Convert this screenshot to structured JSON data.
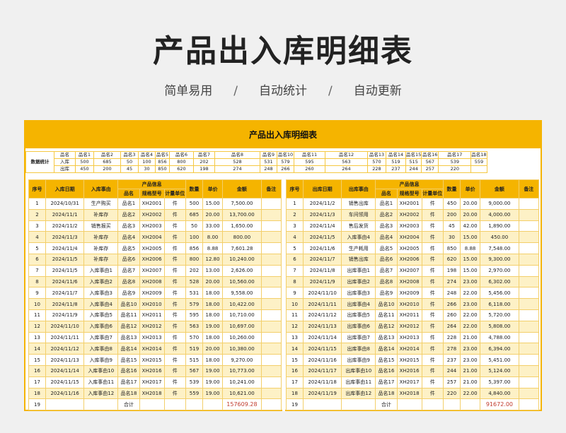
{
  "title": "产品出入库明细表",
  "subtitle": [
    "简单易用",
    "自动统计",
    "自动更新"
  ],
  "subtitle_sep": "/",
  "sheet_title": "产品出入库明细表",
  "stats": {
    "label": "数据统计",
    "row_labels": [
      "品名",
      "入库",
      "出库"
    ],
    "products": [
      "品名1",
      "品名2",
      "品名3",
      "品名4",
      "品名5",
      "品名6",
      "品名7",
      "品名8",
      "品名9",
      "品名10",
      "品名11",
      "品名12",
      "品名13",
      "品名14",
      "品名15",
      "品名16",
      "品名17",
      "品名18"
    ],
    "in": [
      "500",
      "685",
      "50",
      "100",
      "856",
      "800",
      "202",
      "528",
      "531",
      "579",
      "595",
      "563",
      "570",
      "519",
      "515",
      "567",
      "539",
      "559"
    ],
    "out": [
      "450",
      "200",
      "45",
      "30",
      "850",
      "620",
      "198",
      "274",
      "248",
      "266",
      "260",
      "264",
      "228",
      "237",
      "244",
      "257",
      "220",
      ""
    ]
  },
  "headers": {
    "seq": "序号",
    "product_info": "产品信息",
    "name": "品名",
    "model": "规格型号",
    "unit": "计量单位",
    "qty": "数量",
    "price": "单价",
    "amount": "金额",
    "note": "备注"
  },
  "inbound": {
    "date_header": "入库日期",
    "reason_header": "入库事由",
    "rows": [
      [
        "1",
        "2024/10/31",
        "生产购买",
        "品名1",
        "XH2001",
        "件",
        "500",
        "15.00",
        "7,500.00",
        ""
      ],
      [
        "2",
        "2024/11/1",
        "补库存",
        "品名2",
        "XH2002",
        "件",
        "685",
        "20.00",
        "13,700.00",
        ""
      ],
      [
        "3",
        "2024/11/2",
        "销售报买",
        "品名3",
        "XH2003",
        "件",
        "50",
        "33.00",
        "1,650.00",
        ""
      ],
      [
        "4",
        "2024/11/3",
        "补库存",
        "品名4",
        "XH2004",
        "件",
        "100",
        "8.00",
        "800.00",
        ""
      ],
      [
        "5",
        "2024/11/4",
        "补库存",
        "品名5",
        "XH2005",
        "件",
        "856",
        "8.88",
        "7,601.28",
        ""
      ],
      [
        "6",
        "2024/11/5",
        "补库存",
        "品名6",
        "XH2006",
        "件",
        "800",
        "12.80",
        "10,240.00",
        ""
      ],
      [
        "7",
        "2024/11/5",
        "入库事由1",
        "品名7",
        "XH2007",
        "件",
        "202",
        "13.00",
        "2,626.00",
        ""
      ],
      [
        "8",
        "2024/11/6",
        "入库事由2",
        "品名8",
        "XH2008",
        "件",
        "528",
        "20.00",
        "10,560.00",
        ""
      ],
      [
        "9",
        "2024/11/7",
        "入库事由3",
        "品名9",
        "XH2009",
        "件",
        "531",
        "18.00",
        "9,558.00",
        ""
      ],
      [
        "10",
        "2024/11/8",
        "入库事由4",
        "品名10",
        "XH2010",
        "件",
        "579",
        "18.00",
        "10,422.00",
        ""
      ],
      [
        "11",
        "2024/11/9",
        "入库事由5",
        "品名11",
        "XH2011",
        "件",
        "595",
        "18.00",
        "10,710.00",
        ""
      ],
      [
        "12",
        "2024/11/10",
        "入库事由6",
        "品名12",
        "XH2012",
        "件",
        "563",
        "19.00",
        "10,697.00",
        ""
      ],
      [
        "13",
        "2024/11/11",
        "入库事由7",
        "品名13",
        "XH2013",
        "件",
        "570",
        "18.00",
        "10,260.00",
        ""
      ],
      [
        "14",
        "2024/11/12",
        "入库事由8",
        "品名14",
        "XH2014",
        "件",
        "519",
        "20.00",
        "10,380.00",
        ""
      ],
      [
        "15",
        "2024/11/13",
        "入库事由9",
        "品名15",
        "XH2015",
        "件",
        "515",
        "18.00",
        "9,270.00",
        ""
      ],
      [
        "16",
        "2024/11/14",
        "入库事由10",
        "品名16",
        "XH2016",
        "件",
        "567",
        "19.00",
        "10,773.00",
        ""
      ],
      [
        "17",
        "2024/11/15",
        "入库事由11",
        "品名17",
        "XH2017",
        "件",
        "539",
        "19.00",
        "10,241.00",
        ""
      ],
      [
        "18",
        "2024/11/16",
        "入库事由12",
        "品名18",
        "XH2018",
        "件",
        "559",
        "19.00",
        "10,621.00",
        ""
      ]
    ],
    "total_seq": "19",
    "total_label": "合计",
    "total_amount": "157609.28"
  },
  "outbound": {
    "date_header": "出库日期",
    "reason_header": "出库事由",
    "rows": [
      [
        "1",
        "2024/11/2",
        "销售出库",
        "品名1",
        "XH2001",
        "件",
        "450",
        "20.00",
        "9,000.00",
        ""
      ],
      [
        "2",
        "2024/11/3",
        "车间领用",
        "品名2",
        "XH2002",
        "件",
        "200",
        "20.00",
        "4,000.00",
        ""
      ],
      [
        "3",
        "2024/11/4",
        "售后发货",
        "品名3",
        "XH2003",
        "件",
        "45",
        "42.00",
        "1,890.00",
        ""
      ],
      [
        "4",
        "2024/11/5",
        "入库事由4",
        "品名4",
        "XH2004",
        "件",
        "30",
        "15.00",
        "450.00",
        ""
      ],
      [
        "5",
        "2024/11/6",
        "生产耗用",
        "品名5",
        "XH2005",
        "件",
        "850",
        "8.88",
        "7,548.00",
        ""
      ],
      [
        "6",
        "2024/11/7",
        "销售出库",
        "品名6",
        "XH2006",
        "件",
        "620",
        "15.00",
        "9,300.00",
        ""
      ],
      [
        "7",
        "2024/11/8",
        "出库事由1",
        "品名7",
        "XH2007",
        "件",
        "198",
        "15.00",
        "2,970.00",
        ""
      ],
      [
        "8",
        "2024/11/9",
        "出库事由2",
        "品名8",
        "XH2008",
        "件",
        "274",
        "23.00",
        "6,302.00",
        ""
      ],
      [
        "9",
        "2024/11/10",
        "出库事由3",
        "品名9",
        "XH2009",
        "件",
        "248",
        "22.00",
        "5,456.00",
        ""
      ],
      [
        "10",
        "2024/11/11",
        "出库事由4",
        "品名10",
        "XH2010",
        "件",
        "266",
        "23.00",
        "6,118.00",
        ""
      ],
      [
        "11",
        "2024/11/12",
        "出库事由5",
        "品名11",
        "XH2011",
        "件",
        "260",
        "22.00",
        "5,720.00",
        ""
      ],
      [
        "12",
        "2024/11/13",
        "出库事由6",
        "品名12",
        "XH2012",
        "件",
        "264",
        "22.00",
        "5,808.00",
        ""
      ],
      [
        "13",
        "2024/11/14",
        "出库事由7",
        "品名13",
        "XH2013",
        "件",
        "228",
        "21.00",
        "4,788.00",
        ""
      ],
      [
        "14",
        "2024/11/15",
        "出库事由8",
        "品名14",
        "XH2014",
        "件",
        "278",
        "23.00",
        "6,394.00",
        ""
      ],
      [
        "15",
        "2024/11/16",
        "出库事由9",
        "品名15",
        "XH2015",
        "件",
        "237",
        "23.00",
        "5,451.00",
        ""
      ],
      [
        "16",
        "2024/11/17",
        "出库事由10",
        "品名16",
        "XH2016",
        "件",
        "244",
        "21.00",
        "5,124.00",
        ""
      ],
      [
        "17",
        "2024/11/18",
        "出库事由11",
        "品名17",
        "XH2017",
        "件",
        "257",
        "21.00",
        "5,397.00",
        ""
      ],
      [
        "18",
        "2024/11/19",
        "出库事由12",
        "品名18",
        "XH2018",
        "件",
        "220",
        "22.00",
        "4,840.00",
        ""
      ]
    ],
    "total_seq": "19",
    "total_label": "合计",
    "total_amount": "91672.00"
  }
}
